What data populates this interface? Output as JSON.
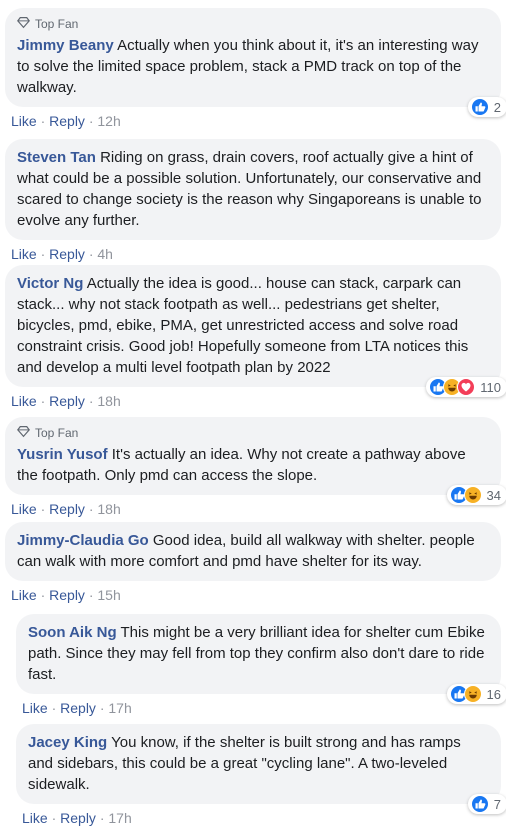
{
  "comments": [
    {
      "badge": "Top Fan",
      "author": "Jimmy Beany",
      "text": "Actually when you think about it, it's an interesting way to solve the limited space problem, stack a PMD track on top of the walkway.",
      "like": "Like",
      "reply": "Reply",
      "time": "12h",
      "reactions": [
        "like"
      ],
      "count": "2"
    },
    {
      "author": "Steven Tan",
      "text": "Riding on grass, drain covers, roof actually give a hint of what could be a possible solution. Unfortunately, our conservative and scared to change society is the reason why Singaporeans is unable to evolve any further.",
      "like": "Like",
      "reply": "Reply",
      "time": "4h"
    },
    {
      "author": "Victor Ng",
      "text": "Actually the idea is good... house can stack, carpark can stack... why not stack footpath as well... pedestrians get shelter, bicycles, pmd, ebike, PMA, get unrestricted access and solve road constraint crisis. Good job! Hopefully someone from LTA notices this and develop a multi level footpath plan by 2022",
      "like": "Like",
      "reply": "Reply",
      "time": "18h",
      "reactions": [
        "like",
        "haha",
        "love"
      ],
      "count": "110"
    },
    {
      "badge": "Top Fan",
      "author": "Yusrin Yusof",
      "text": "It's actually an idea. Why not create a pathway above the footpath. Only pmd can access the slope.",
      "like": "Like",
      "reply": "Reply",
      "time": "18h",
      "reactions": [
        "like",
        "haha"
      ],
      "count": "34"
    },
    {
      "author": "Jimmy-Claudia Go",
      "text": "Good idea, build all walkway with shelter. people can walk with more comfort and pmd have shelter for its way.",
      "like": "Like",
      "reply": "Reply",
      "time": "15h"
    },
    {
      "author": "Soon Aik Ng",
      "text": "This might be a very brilliant idea for shelter cum Ebike path. Since they may fell from top they confirm also don't dare to ride fast.",
      "like": "Like",
      "reply": "Reply",
      "time": "17h",
      "reactions": [
        "like",
        "haha"
      ],
      "count": "16"
    },
    {
      "author": "Jacey King",
      "text": "You know, if the shelter is built strong and has ramps and sidebars, this could be a great \"cycling lane\". A two-leveled sidewalk.",
      "like": "Like",
      "reply": "Reply",
      "time": "17h",
      "reactions": [
        "like"
      ],
      "count": "7"
    }
  ],
  "separator": "·",
  "colors": {
    "link": "#385898",
    "bubble": "#f2f3f5",
    "like": "#1877f2",
    "haha": "#f7b125",
    "love": "#f33e58"
  }
}
